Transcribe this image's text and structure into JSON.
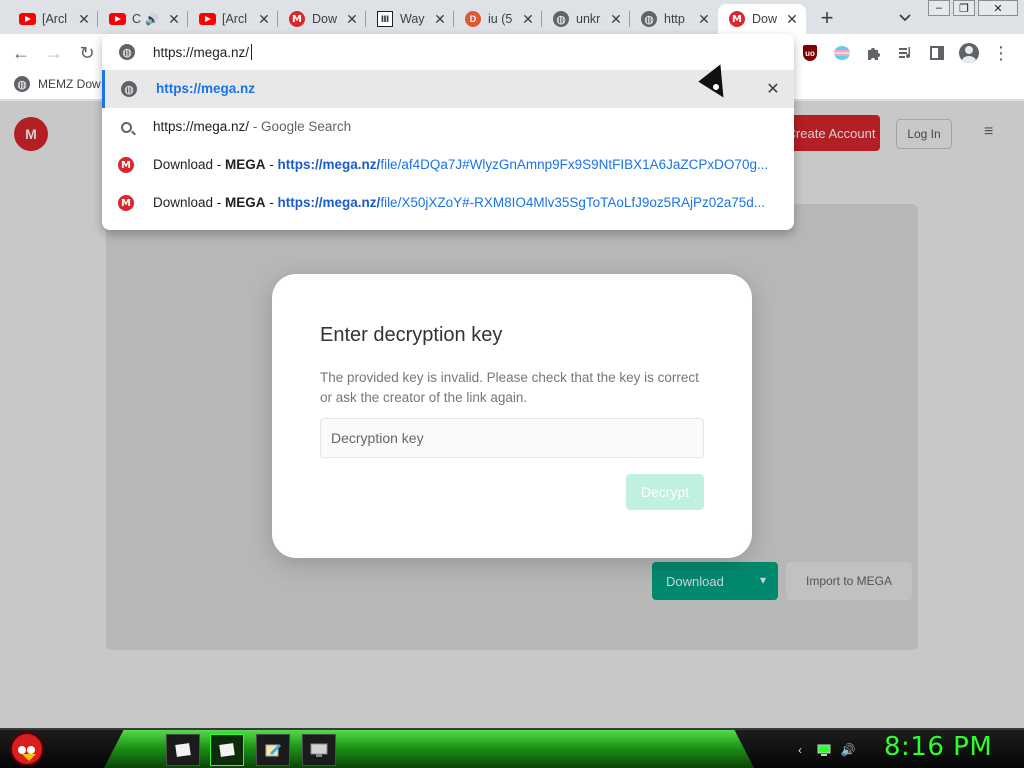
{
  "tabs": [
    {
      "title": "[Arcl",
      "favicon": "youtube-icon",
      "audio": false
    },
    {
      "title": "C",
      "favicon": "youtube-icon",
      "audio": true
    },
    {
      "title": "[Arcl",
      "favicon": "youtube-icon",
      "audio": false
    },
    {
      "title": "Dow",
      "favicon": "mega-icon",
      "audio": false
    },
    {
      "title": "Way",
      "favicon": "wayback-icon",
      "audio": false
    },
    {
      "title": "iu (5",
      "favicon": "duckduckgo-icon",
      "audio": false
    },
    {
      "title": "unkr",
      "favicon": "globe-icon",
      "audio": false
    },
    {
      "title": "http",
      "favicon": "globe-icon",
      "audio": false
    },
    {
      "title": "Dow",
      "favicon": "mega-icon",
      "audio": false,
      "active": true
    }
  ],
  "tab_close_glyph": "✕",
  "new_tab_glyph": "+",
  "tab_search_glyph": "⌄",
  "window_controls": {
    "minimize": "–",
    "maximize": "❐",
    "close": "✕"
  },
  "omnibox": {
    "value": "https://mega.nz/",
    "suggestions": [
      {
        "kind": "url",
        "text": "https://mega.nz",
        "icon": "globe-icon",
        "selected": true
      },
      {
        "kind": "search",
        "text": "https://mega.nz/",
        "suffix": " - Google Search",
        "icon": "search-icon"
      },
      {
        "kind": "history",
        "prefix": "Download - ",
        "bold": "MEGA",
        "sep": " - ",
        "url_bold": "https://mega.nz/",
        "url_rest": "file/af4DQa7J#WlyzGnAmnp9Fx9S9NtFIBX1A6JaZCPxDO70g...",
        "icon": "mega-icon"
      },
      {
        "kind": "history",
        "prefix": "Download - ",
        "bold": "MEGA",
        "sep": " - ",
        "url_bold": "https://mega.nz/",
        "url_rest": "file/X50jXZoY#-RXM8IO4Mlv35SgToTAoLfJ9oz5RAjPz02a75d...",
        "icon": "mega-icon"
      }
    ],
    "remove_glyph": "✕"
  },
  "toolbar": {
    "back": "←",
    "forward": "→",
    "reload": "↻",
    "ublock_label": "uo",
    "menu": "⋮"
  },
  "bookmarks": [
    {
      "label": "MEMZ Dow",
      "icon": "globe-icon"
    }
  ],
  "page": {
    "logo": "M",
    "create_account": "Create Account",
    "login": "Log In",
    "menu_glyph": "≡",
    "download": "Download",
    "import": "Import to MEGA"
  },
  "modal": {
    "title": "Enter decryption key",
    "message": "The provided key is invalid. Please check that the key is correct or ask the creator of the link again.",
    "input_placeholder": "Decryption key",
    "button": "Decrypt"
  },
  "taskbar": {
    "clock": "8:16 PM",
    "colors": {
      "accent": "#2cff2c",
      "mega_red": "#d9272e",
      "mega_green": "#00a886"
    }
  }
}
